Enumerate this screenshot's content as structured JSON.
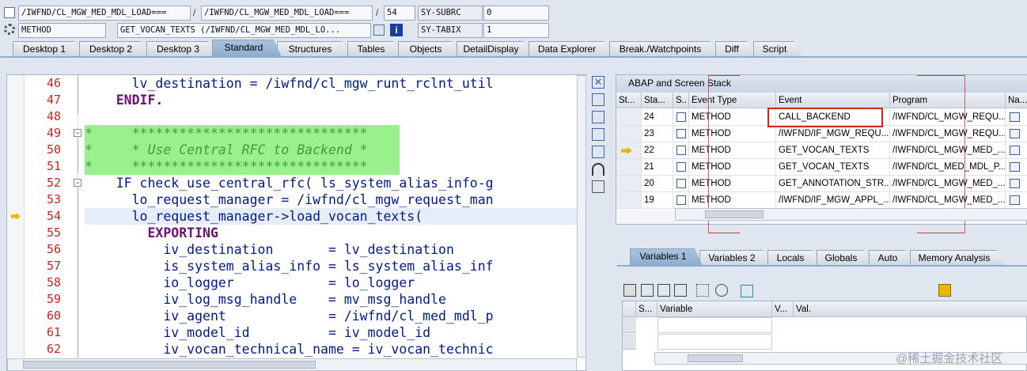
{
  "header": {
    "row1": {
      "field1": "/IWFND/CL_MGW_MED_MDL_LOAD===",
      "sep1": "/",
      "field2": "/IWFND/CL_MGW_MED_MDL_LOAD===",
      "sep2": "/",
      "line_no": "54",
      "sysfield": "SY-SUBRC",
      "sysvalue": "0"
    },
    "row2": {
      "type": "METHOD",
      "method": "GET_VOCAN_TEXTS (/IWFND/CL_MGW_MED_MDL_LO...",
      "sysfield": "SY-TABIX",
      "sysvalue": "1"
    }
  },
  "tabs": [
    "Desktop 1",
    "Desktop 2",
    "Desktop 3",
    "Standard",
    "Structures",
    "Tables",
    "Objects",
    "DetailDisplay",
    "Data Explorer",
    "Break./Watchpoints",
    "Diff",
    "Script"
  ],
  "active_tab": "Standard",
  "code": {
    "lines": [
      {
        "n": "46",
        "t": "      lv_destination = /iwfnd/cl_mgw_runt_rclnt_util"
      },
      {
        "n": "47",
        "t": "    ENDIF."
      },
      {
        "n": "48",
        "t": ""
      },
      {
        "n": "49",
        "t": "*     ******************************"
      },
      {
        "n": "50",
        "t": "*     * Use Central RFC to Backend *"
      },
      {
        "n": "51",
        "t": "*     ******************************"
      },
      {
        "n": "52",
        "t": "    IF check_use_central_rfc( ls_system_alias_info-g"
      },
      {
        "n": "53",
        "t": "      lo_request_manager = /iwfnd/cl_mgw_request_man"
      },
      {
        "n": "54",
        "t": "      lo_request_manager->load_vocan_texts("
      },
      {
        "n": "55",
        "t": "        EXPORTING"
      },
      {
        "n": "56",
        "t": "          iv_destination       = lv_destination"
      },
      {
        "n": "57",
        "t": "          is_system_alias_info = ls_system_alias_inf"
      },
      {
        "n": "58",
        "t": "          io_logger            = lo_logger"
      },
      {
        "n": "59",
        "t": "          iv_log_msg_handle    = mv_msg_handle"
      },
      {
        "n": "60",
        "t": "          iv_agent             = /iwfnd/cl_med_mdl_p"
      },
      {
        "n": "61",
        "t": "          iv_model_id          = iv_model_id"
      },
      {
        "n": "62",
        "t": "          iv_vocan_technical_name = iv_vocan_technic"
      }
    ]
  },
  "stack": {
    "title": "ABAP and Screen Stack",
    "columns": [
      "St...",
      "Sta...",
      "S..",
      "Event Type",
      "Event",
      "Program",
      "Na..."
    ],
    "rows": [
      {
        "level": "24",
        "type": "METHOD",
        "event": "CALL_BACKEND",
        "program": "/IWFND/CL_MGW_REQU...",
        "current": false
      },
      {
        "level": "23",
        "type": "METHOD",
        "event": "/IWFND/IF_MGW_REQU...",
        "program": "/IWFND/CL_MGW_REQU...",
        "current": false
      },
      {
        "level": "22",
        "type": "METHOD",
        "event": "GET_VOCAN_TEXTS",
        "program": "/IWFND/CL_MGW_MED_...",
        "current": true
      },
      {
        "level": "21",
        "type": "METHOD",
        "event": "GET_VOCAN_TEXTS",
        "program": "/IWFND/CL_MED_MDL_P...",
        "current": false
      },
      {
        "level": "20",
        "type": "METHOD",
        "event": "GET_ANNOTATION_STR...",
        "program": "/IWFND/CL_MGW_MED_...",
        "current": false
      },
      {
        "level": "19",
        "type": "METHOD",
        "event": "/IWFND/IF_MGW_APPL_...",
        "program": "/IWFND/CL_MGW_MED_...",
        "current": false
      }
    ]
  },
  "vartabs": [
    "Variables 1",
    "Variables 2",
    "Locals",
    "Globals",
    "Auto",
    "Memory Analysis"
  ],
  "active_vartab": "Variables 1",
  "vars": {
    "columns": [
      "S...",
      "Variable",
      "V...",
      "Val."
    ]
  },
  "watermark": "@稀土掘金技术社区"
}
